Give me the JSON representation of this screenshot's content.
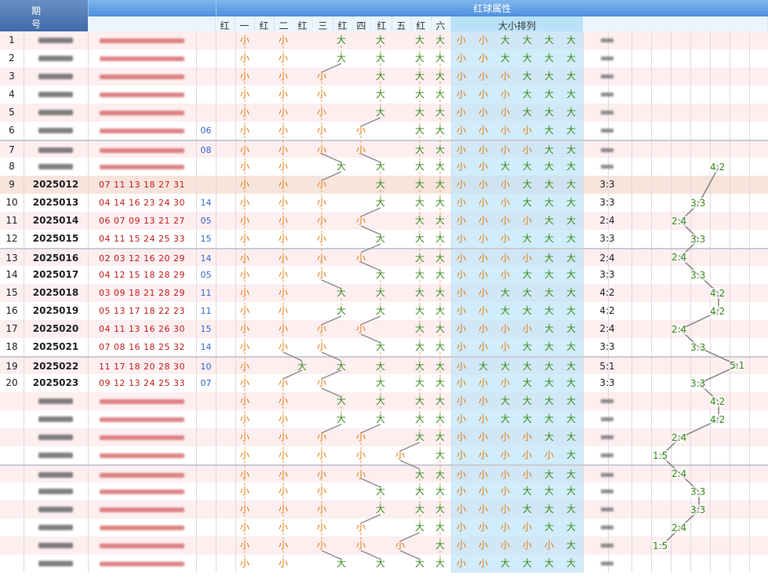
{
  "header": {
    "period_label_top": "期",
    "period_label_bottom": "号",
    "group_title": "红球属性",
    "subcols": [
      "红",
      "一",
      "红",
      "二",
      "红",
      "三",
      "红",
      "四",
      "红",
      "五",
      "红",
      "六"
    ],
    "size_title": "大小排列"
  },
  "rows": [
    {
      "idx": "1",
      "period": "",
      "reds": "",
      "blue": "",
      "pos": [
        "小",
        "小",
        "大",
        "大",
        "大",
        "大"
      ],
      "sizes": [
        "小",
        "小",
        "大",
        "大",
        "大",
        "大"
      ],
      "ratio": "",
      "blur": true
    },
    {
      "idx": "2",
      "period": "",
      "reds": "",
      "blue": "",
      "pos": [
        "小",
        "小",
        "大",
        "大",
        "大",
        "大"
      ],
      "sizes": [
        "小",
        "小",
        "大",
        "大",
        "大",
        "大"
      ],
      "ratio": "",
      "blur": true
    },
    {
      "idx": "3",
      "period": "",
      "reds": "",
      "blue": "",
      "pos": [
        "小",
        "小",
        "小",
        "大",
        "大",
        "大"
      ],
      "sizes": [
        "小",
        "小",
        "小",
        "大",
        "大",
        "大"
      ],
      "ratio": "",
      "blur": true
    },
    {
      "idx": "4",
      "period": "",
      "reds": "",
      "blue": "",
      "pos": [
        "小",
        "小",
        "小",
        "大",
        "大",
        "大"
      ],
      "sizes": [
        "小",
        "小",
        "小",
        "大",
        "大",
        "大"
      ],
      "ratio": "",
      "blur": true
    },
    {
      "idx": "5",
      "period": "",
      "reds": "",
      "blue": "",
      "pos": [
        "小",
        "小",
        "小",
        "大",
        "大",
        "大"
      ],
      "sizes": [
        "小",
        "小",
        "小",
        "大",
        "大",
        "大"
      ],
      "ratio": "",
      "blur": true
    },
    {
      "idx": "6",
      "period": "",
      "reds": "",
      "blue": "06",
      "pos": [
        "小",
        "小",
        "小",
        "小",
        "大",
        "大"
      ],
      "sizes": [
        "小",
        "小",
        "小",
        "小",
        "大",
        "大"
      ],
      "ratio": "",
      "blur": true
    },
    {
      "idx": "7",
      "period": "",
      "reds": "",
      "blue": "08",
      "pos": [
        "小",
        "小",
        "小",
        "小",
        "大",
        "大"
      ],
      "sizes": [
        "小",
        "小",
        "小",
        "小",
        "大",
        "大"
      ],
      "ratio": "",
      "blur": true
    },
    {
      "idx": "8",
      "period": "",
      "reds": "",
      "blue": "",
      "pos": [
        "小",
        "小",
        "大",
        "大",
        "大",
        "大"
      ],
      "sizes": [
        "小",
        "小",
        "大",
        "大",
        "大",
        "大"
      ],
      "ratio": "",
      "blur": true,
      "trend": "4:2"
    },
    {
      "idx": "9",
      "period": "2025012",
      "reds": "07 11 13 18 27 31",
      "blue": "",
      "pos": [
        "小",
        "小",
        "小",
        "大",
        "大",
        "大"
      ],
      "sizes": [
        "小",
        "小",
        "小",
        "大",
        "大",
        "大"
      ],
      "ratio": "3:3"
    },
    {
      "idx": "10",
      "period": "2025013",
      "reds": "04 14 16 23 24 30",
      "blue": "14",
      "pos": [
        "小",
        "小",
        "小",
        "大",
        "大",
        "大"
      ],
      "sizes": [
        "小",
        "小",
        "小",
        "大",
        "大",
        "大"
      ],
      "ratio": "3:3",
      "trend": "3:3"
    },
    {
      "idx": "11",
      "period": "2025014",
      "reds": "06 07 09 13 21 27",
      "blue": "05",
      "pos": [
        "小",
        "小",
        "小",
        "小",
        "大",
        "大"
      ],
      "sizes": [
        "小",
        "小",
        "小",
        "小",
        "大",
        "大"
      ],
      "ratio": "2:4",
      "trend": "2:4"
    },
    {
      "idx": "12",
      "period": "2025015",
      "reds": "04 11 15 24 25 33",
      "blue": "15",
      "pos": [
        "小",
        "小",
        "小",
        "大",
        "大",
        "大"
      ],
      "sizes": [
        "小",
        "小",
        "小",
        "大",
        "大",
        "大"
      ],
      "ratio": "3:3",
      "trend": "3:3"
    },
    {
      "idx": "13",
      "period": "2025016",
      "reds": "02 03 12 16 20 29",
      "blue": "14",
      "pos": [
        "小",
        "小",
        "小",
        "小",
        "大",
        "大"
      ],
      "sizes": [
        "小",
        "小",
        "小",
        "小",
        "大",
        "大"
      ],
      "ratio": "2:4",
      "trend": "2:4"
    },
    {
      "idx": "14",
      "period": "2025017",
      "reds": "04 12 15 18 28 29",
      "blue": "05",
      "pos": [
        "小",
        "小",
        "小",
        "大",
        "大",
        "大"
      ],
      "sizes": [
        "小",
        "小",
        "小",
        "大",
        "大",
        "大"
      ],
      "ratio": "3:3",
      "trend": "3:3"
    },
    {
      "idx": "15",
      "period": "2025018",
      "reds": "03 09 18 21 28 29",
      "blue": "11",
      "pos": [
        "小",
        "小",
        "大",
        "大",
        "大",
        "大"
      ],
      "sizes": [
        "小",
        "小",
        "大",
        "大",
        "大",
        "大"
      ],
      "ratio": "4:2",
      "trend": "4:2"
    },
    {
      "idx": "16",
      "period": "2025019",
      "reds": "05 13 17 18 22 23",
      "blue": "11",
      "pos": [
        "小",
        "小",
        "大",
        "大",
        "大",
        "大"
      ],
      "sizes": [
        "小",
        "小",
        "大",
        "大",
        "大",
        "大"
      ],
      "ratio": "4:2",
      "trend": "4:2"
    },
    {
      "idx": "17",
      "period": "2025020",
      "reds": "04 11 13 16 26 30",
      "blue": "15",
      "pos": [
        "小",
        "小",
        "小",
        "小",
        "大",
        "大"
      ],
      "sizes": [
        "小",
        "小",
        "小",
        "小",
        "大",
        "大"
      ],
      "ratio": "2:4",
      "trend": "2:4"
    },
    {
      "idx": "18",
      "period": "2025021",
      "reds": "07 08 16 18 25 32",
      "blue": "14",
      "pos": [
        "小",
        "小",
        "小",
        "大",
        "大",
        "大"
      ],
      "sizes": [
        "小",
        "小",
        "小",
        "大",
        "大",
        "大"
      ],
      "ratio": "3:3",
      "trend": "3:3"
    },
    {
      "idx": "19",
      "period": "2025022",
      "reds": "11 17 18 20 28 30",
      "blue": "10",
      "pos": [
        "小",
        "大",
        "大",
        "大",
        "大",
        "大"
      ],
      "sizes": [
        "小",
        "大",
        "大",
        "大",
        "大",
        "大"
      ],
      "ratio": "5:1",
      "trend": "5:1"
    },
    {
      "idx": "20",
      "period": "2025023",
      "reds": "09 12 13 24 25 33",
      "blue": "07",
      "pos": [
        "小",
        "小",
        "小",
        "大",
        "大",
        "大"
      ],
      "sizes": [
        "小",
        "小",
        "小",
        "大",
        "大",
        "大"
      ],
      "ratio": "3:3",
      "trend": "3:3"
    },
    {
      "idx": "",
      "period": "",
      "reds": "",
      "blue": "",
      "pos": [
        "小",
        "小",
        "大",
        "大",
        "大",
        "大"
      ],
      "sizes": [
        "小",
        "小",
        "大",
        "大",
        "大",
        "大"
      ],
      "ratio": "",
      "blur": true,
      "trend": "4:2"
    },
    {
      "idx": "",
      "period": "",
      "reds": "",
      "blue": "",
      "pos": [
        "小",
        "小",
        "大",
        "大",
        "大",
        "大"
      ],
      "sizes": [
        "小",
        "小",
        "大",
        "大",
        "大",
        "大"
      ],
      "ratio": "",
      "blur": true,
      "trend": "4:2"
    },
    {
      "idx": "",
      "period": "",
      "reds": "",
      "blue": "",
      "pos": [
        "小",
        "小",
        "小",
        "小",
        "大",
        "大"
      ],
      "sizes": [
        "小",
        "小",
        "小",
        "小",
        "大",
        "大"
      ],
      "ratio": "",
      "blur": true,
      "trend": "2:4"
    },
    {
      "idx": "",
      "period": "",
      "reds": "",
      "blue": "",
      "pos": [
        "小",
        "小",
        "小",
        "小",
        "小",
        "大"
      ],
      "sizes": [
        "小",
        "小",
        "小",
        "小",
        "小",
        "大"
      ],
      "ratio": "",
      "blur": true,
      "trend": "1:5"
    },
    {
      "idx": "",
      "period": "",
      "reds": "",
      "blue": "",
      "pos": [
        "小",
        "小",
        "小",
        "小",
        "大",
        "大"
      ],
      "sizes": [
        "小",
        "小",
        "小",
        "小",
        "大",
        "大"
      ],
      "ratio": "",
      "blur": true,
      "trend": "2:4"
    },
    {
      "idx": "",
      "period": "",
      "reds": "",
      "blue": "",
      "pos": [
        "小",
        "小",
        "小",
        "大",
        "大",
        "大"
      ],
      "sizes": [
        "小",
        "小",
        "小",
        "大",
        "大",
        "大"
      ],
      "ratio": "",
      "blur": true,
      "trend": "3:3"
    },
    {
      "idx": "",
      "period": "",
      "reds": "",
      "blue": "",
      "pos": [
        "小",
        "小",
        "小",
        "大",
        "大",
        "大"
      ],
      "sizes": [
        "小",
        "小",
        "小",
        "大",
        "大",
        "大"
      ],
      "ratio": "",
      "blur": true,
      "trend": "3:3"
    },
    {
      "idx": "",
      "period": "",
      "reds": "",
      "blue": "",
      "pos": [
        "小",
        "小",
        "小",
        "小",
        "大",
        "大"
      ],
      "sizes": [
        "小",
        "小",
        "小",
        "小",
        "大",
        "大"
      ],
      "ratio": "",
      "blur": true,
      "trend": "2:4"
    },
    {
      "idx": "",
      "period": "",
      "reds": "",
      "blue": "",
      "pos": [
        "小",
        "小",
        "小",
        "小",
        "小",
        "大"
      ],
      "sizes": [
        "小",
        "小",
        "小",
        "小",
        "小",
        "大"
      ],
      "ratio": "",
      "blur": true,
      "trend": "1:5"
    },
    {
      "idx": "",
      "period": "",
      "reds": "",
      "blue": "",
      "pos": [
        "小",
        "小",
        "大",
        "大",
        "大",
        "大"
      ],
      "sizes": [
        "小",
        "小",
        "大",
        "大",
        "大",
        "大"
      ],
      "ratio": "",
      "blur": true
    }
  ]
}
